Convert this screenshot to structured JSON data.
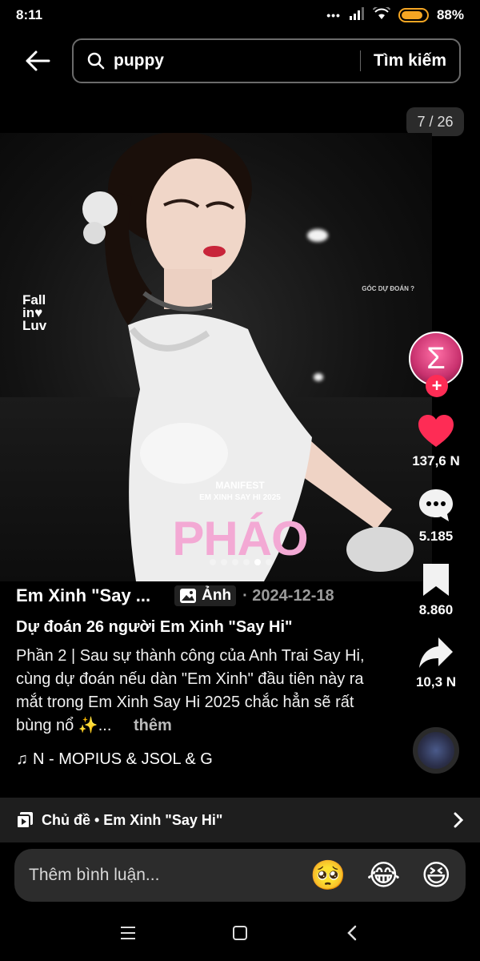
{
  "status_bar": {
    "time": "8:11",
    "battery": "88%",
    "battery_level": 0.88,
    "dots": "•••"
  },
  "search": {
    "query": "puppy",
    "submit_label": "Tìm kiếm"
  },
  "carousel": {
    "counter": "7 / 26",
    "total_dots": 6,
    "active_dot": 5
  },
  "photo": {
    "watermark_lines": [
      "Fall",
      "in♥",
      "Luv"
    ],
    "corner_tag": "GÓC DỰ ĐOÁN ?",
    "manifest_line1": "MANIFEST",
    "manifest_line2": "EM XINH SAY HI 2025",
    "name_text": "PHÁO"
  },
  "creator": {
    "avatar_glyph": "Σ",
    "follow_symbol": "+"
  },
  "actions": {
    "likes": "137,6 N",
    "comments": "5.185",
    "saves": "8.860",
    "shares": "10,3 N"
  },
  "post": {
    "author": "Em Xinh \"Say ...",
    "type_badge": "Ảnh",
    "date": "· 2024-12-18",
    "title": "Dự đoán 26 người Em Xinh \"Say Hi\"",
    "description": "Phần 2 | Sau sự thành công của Anh Trai Say Hi, cùng dự đoán nếu dàn \"Em Xinh\" đầu tiên này ra mắt trong Em Xinh Say Hi 2025 chắc hẳn sẽ rất bùng nổ ✨...",
    "more_label": "thêm",
    "music": "N - MOPIUS & JSOL & G"
  },
  "playlist": {
    "label": "Chủ đề • Em Xinh \"Say Hi\""
  },
  "comment": {
    "placeholder": "Thêm bình luận...",
    "emojis": [
      "🥺",
      "😂",
      "😆"
    ]
  },
  "colors": {
    "like": "#fe2c55",
    "accent_pink": "#f3a9d4",
    "battery": "#f5a623"
  }
}
